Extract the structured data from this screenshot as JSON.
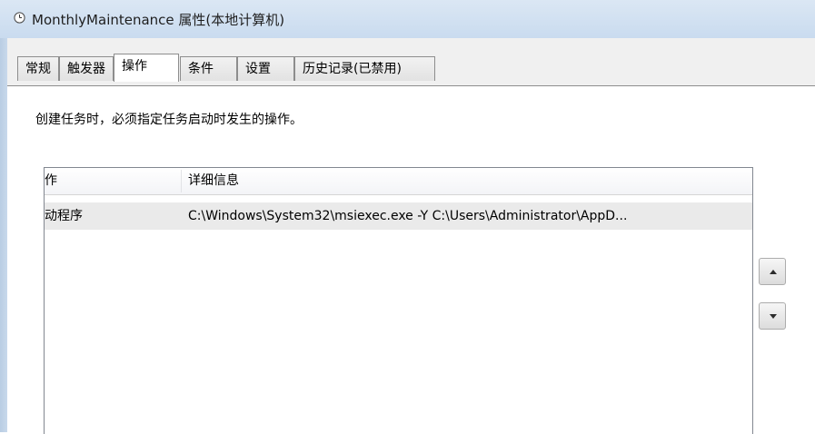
{
  "window": {
    "title": "MonthlyMaintenance 属性(本地计算机)",
    "icon": "clock-icon"
  },
  "tabs": [
    {
      "label": "常规",
      "active": false
    },
    {
      "label": "触发器",
      "active": false
    },
    {
      "label": "操作",
      "active": true
    },
    {
      "label": "条件",
      "active": false
    },
    {
      "label": "设置",
      "active": false
    },
    {
      "label": "历史记录(已禁用)",
      "active": false
    }
  ],
  "actions_tab": {
    "instruction": "创建任务时，必须指定任务启动时发生的操作。",
    "columns": [
      "作",
      "详细信息"
    ],
    "rows": [
      {
        "action": "动程序",
        "details": "C:\\Windows\\System32\\msiexec.exe -Y C:\\Users\\Administrator\\AppD..."
      }
    ],
    "move_up_icon": "triangle-up-icon",
    "move_down_icon": "triangle-down-icon"
  },
  "colors": {
    "frame": "#cfdff0",
    "client": "#f0f0f0",
    "selected_row": "#eaeaea"
  }
}
